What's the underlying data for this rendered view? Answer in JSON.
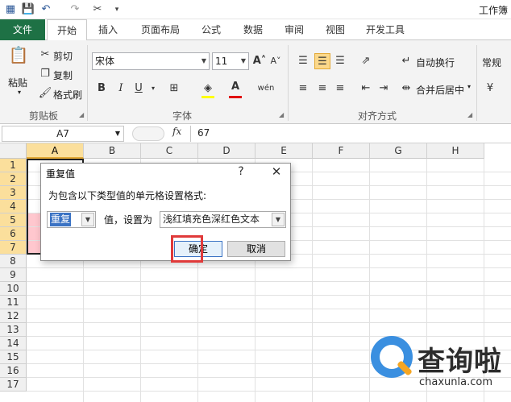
{
  "window": {
    "title": "工作簿"
  },
  "qat": {
    "save_icon": "save-icon",
    "undo_icon": "undo-icon",
    "redo_icon": "redo-icon"
  },
  "tabs": [
    {
      "label": "文件"
    },
    {
      "label": "开始"
    },
    {
      "label": "插入"
    },
    {
      "label": "页面布局"
    },
    {
      "label": "公式"
    },
    {
      "label": "数据"
    },
    {
      "label": "审阅"
    },
    {
      "label": "视图"
    },
    {
      "label": "开发工具"
    }
  ],
  "ribbon": {
    "clipboard": {
      "paste": "粘贴",
      "cut": "剪切",
      "copy": "复制",
      "format_painter": "格式刷",
      "group": "剪贴板"
    },
    "font": {
      "name": "宋体",
      "size": "11",
      "bold": "B",
      "italic": "I",
      "underline": "U",
      "text_color_glyph": "A",
      "phonetic": "wén",
      "group": "字体"
    },
    "alignment": {
      "wrap": "自动换行",
      "merge": "合并后居中",
      "group": "对齐方式"
    },
    "number": {
      "format": "常规"
    }
  },
  "formula_bar": {
    "name_box": "A7",
    "fx": "fx",
    "value": "67"
  },
  "columns": [
    "A",
    "B",
    "C",
    "D",
    "E",
    "F",
    "G",
    "H"
  ],
  "rows": [
    "1",
    "2",
    "3",
    "4",
    "5",
    "6",
    "7",
    "8",
    "9",
    "10",
    "11",
    "12",
    "13",
    "14",
    "15",
    "16",
    "17"
  ],
  "dialog": {
    "title": "重复值",
    "help": "?",
    "close": "✕",
    "prompt": "为包含以下类型值的单元格设置格式:",
    "type_value": "重复",
    "label": "值，设置为",
    "format_value": "浅红填充色深红色文本",
    "ok": "确定",
    "cancel": "取消"
  },
  "watermark": {
    "brand": "查询啦",
    "url": "chaxunla.com"
  },
  "colors": {
    "file_tab": "#1e7145",
    "selection": "#fbdf9c",
    "highlight_box": "#e03a3a",
    "dup_fill": "#ffc7ce"
  }
}
